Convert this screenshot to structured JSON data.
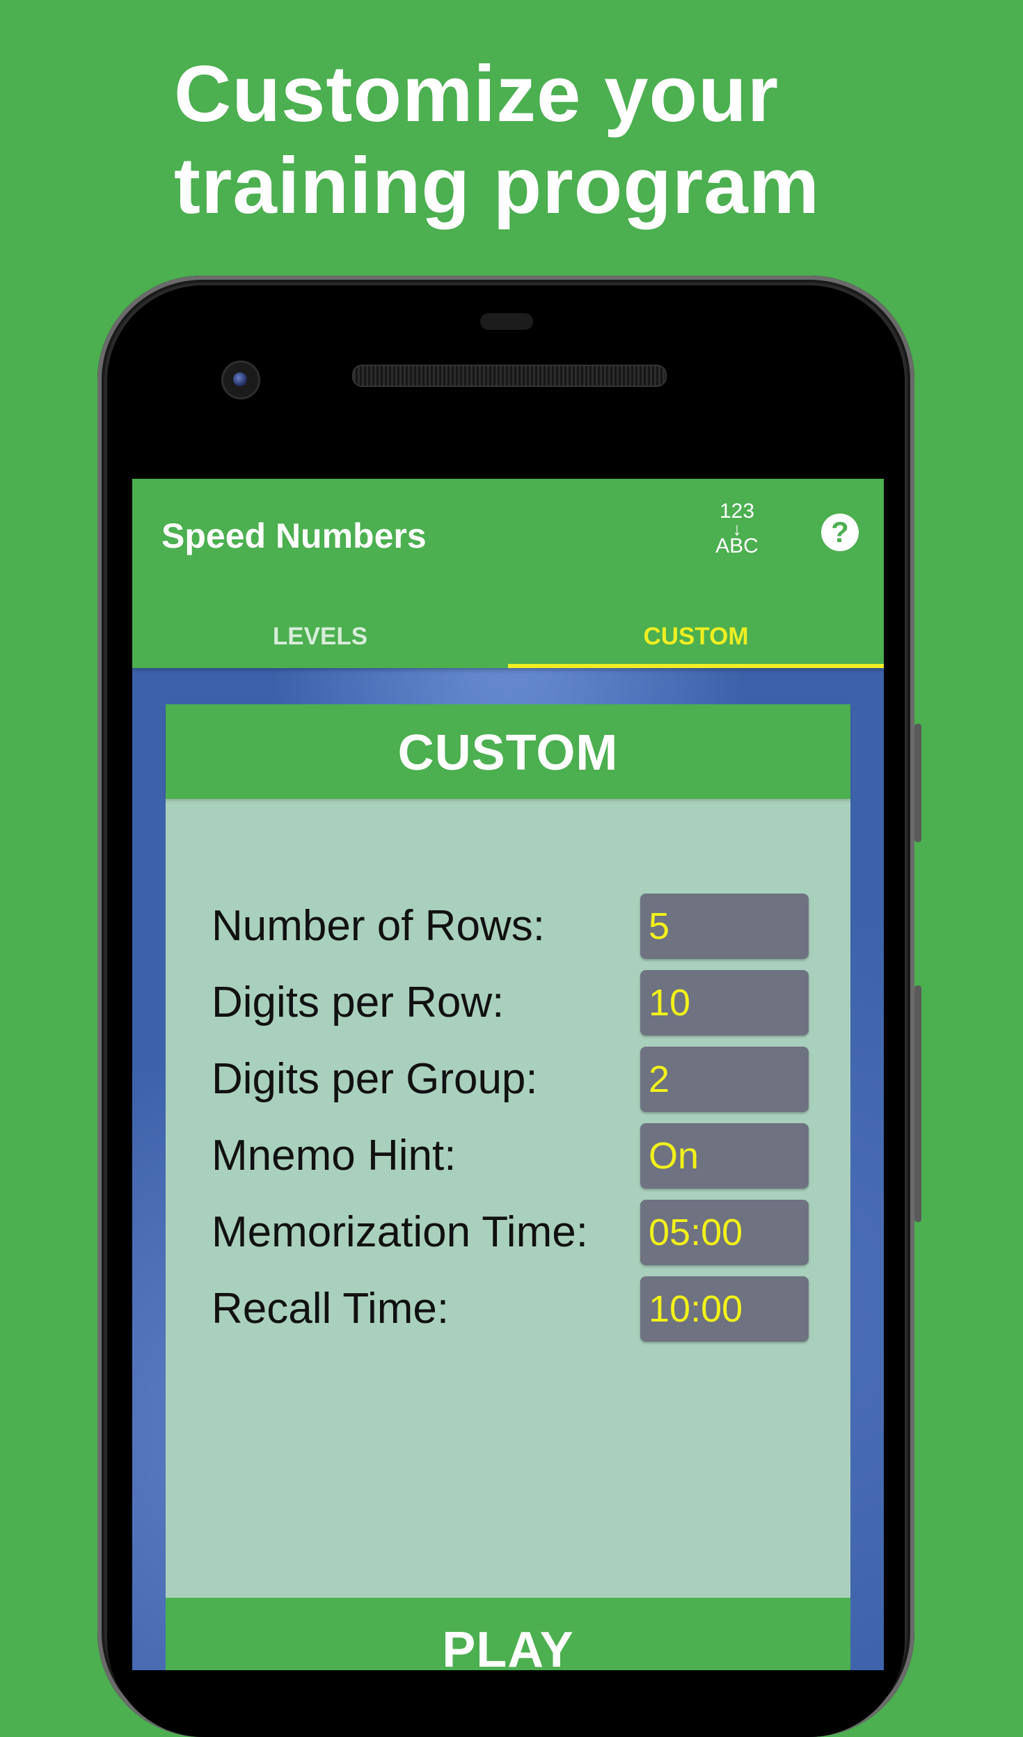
{
  "promo": {
    "headline_line1": "Customize your",
    "headline_line2": "training program"
  },
  "app": {
    "title": "Speed Numbers",
    "sort_icon_top": "123",
    "sort_icon_arrow": "↓",
    "sort_icon_bottom": "ABC",
    "help_icon": "?"
  },
  "tabs": [
    {
      "label": "LEVELS",
      "selected": false
    },
    {
      "label": "CUSTOM",
      "selected": true
    }
  ],
  "card": {
    "title": "CUSTOM",
    "settings": [
      {
        "label": "Number of Rows:",
        "value": "5"
      },
      {
        "label": "Digits per Row:",
        "value": "10"
      },
      {
        "label": "Digits per Group:",
        "value": "2"
      },
      {
        "label": "Mnemo Hint:",
        "value": "On"
      },
      {
        "label": "Memorization Time:",
        "value": "05:00"
      },
      {
        "label": "Recall Time:",
        "value": "10:00"
      }
    ]
  },
  "play_label": "PLAY",
  "colors": {
    "accent_green": "#4caf50",
    "tab_highlight": "#eeee22",
    "value_text": "#f2f21a",
    "value_box": "#6e7281",
    "card_bg": "#a9d0bc"
  }
}
